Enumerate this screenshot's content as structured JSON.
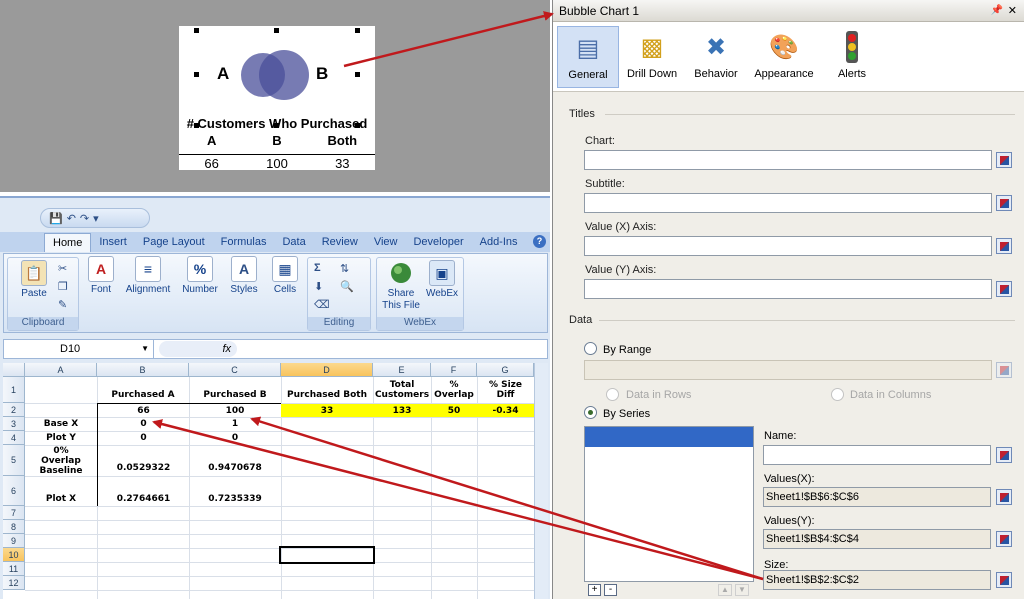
{
  "venn": {
    "label_a": "A",
    "label_b": "B",
    "title": "# Customers Who Purchased",
    "headers": [
      "A",
      "B",
      "Both"
    ],
    "values": [
      "66",
      "100",
      "33"
    ],
    "circle_color": "#4a4f9a"
  },
  "excel": {
    "ribbon_tabs": [
      "Home",
      "Insert",
      "Page Layout",
      "Formulas",
      "Data",
      "Review",
      "View",
      "Developer",
      "Add-Ins"
    ],
    "groups": {
      "clipboard": "Clipboard",
      "editing": "Editing",
      "webex": "WebEx"
    },
    "buttons": {
      "paste": "Paste",
      "font": "Font",
      "alignment": "Alignment",
      "number": "Number",
      "styles": "Styles",
      "cells": "Cells",
      "share": "Share This File",
      "webex": "WebEx"
    },
    "name_box": "D10",
    "fx_label": "fx",
    "columns": [
      "A",
      "B",
      "C",
      "D",
      "E",
      "F",
      "G"
    ],
    "rows": [
      "1",
      "2",
      "3",
      "4",
      "5",
      "6",
      "7",
      "8",
      "9",
      "10",
      "11",
      "12"
    ],
    "cells": {
      "b1": "Purchased A",
      "c1": "Purchased B",
      "d1": "Purchased Both",
      "e1": "Total Customers",
      "f1": "% Overlap",
      "g1": "% Size Diff",
      "b2": "66",
      "c2": "100",
      "d2": "33",
      "e2": "133",
      "f2": "50",
      "g2": "-0.34",
      "a3": "Base X",
      "b3": "0",
      "c3": "1",
      "a4": "Plot Y",
      "b4": "0",
      "c4": "0",
      "a5": "0% Overlap Baseline",
      "b5": "0.0529322",
      "c5": "0.9470678",
      "a6": "Plot X",
      "b6": "0.2764661",
      "c6": "0.7235339"
    }
  },
  "panel": {
    "title": "Bubble Chart 1",
    "toolbar": [
      "General",
      "Drill Down",
      "Behavior",
      "Appearance",
      "Alerts"
    ],
    "sections": {
      "titles": "Titles",
      "data": "Data"
    },
    "fields": {
      "chart": "Chart:",
      "subtitle": "Subtitle:",
      "value_x_axis": "Value (X) Axis:",
      "value_y_axis": "Value (Y) Axis:"
    },
    "by_range": "By Range",
    "data_in_rows": "Data in Rows",
    "data_in_columns": "Data in Columns",
    "by_series": "By Series",
    "series": {
      "name_label": "Name:",
      "name_value": "",
      "values_x_label": "Values(X):",
      "values_x": "Sheet1!$B$6:$C$6",
      "values_y_label": "Values(Y):",
      "values_y": "Sheet1!$B$4:$C$4",
      "size_label": "Size:",
      "size": "Sheet1!$B$2:$C$2"
    },
    "add_symbol": "+",
    "remove_symbol": "-"
  },
  "colors": {
    "arrow": "#c0191c",
    "selected_series": "#3168c6",
    "yellow_highlight": "#ffff00"
  }
}
